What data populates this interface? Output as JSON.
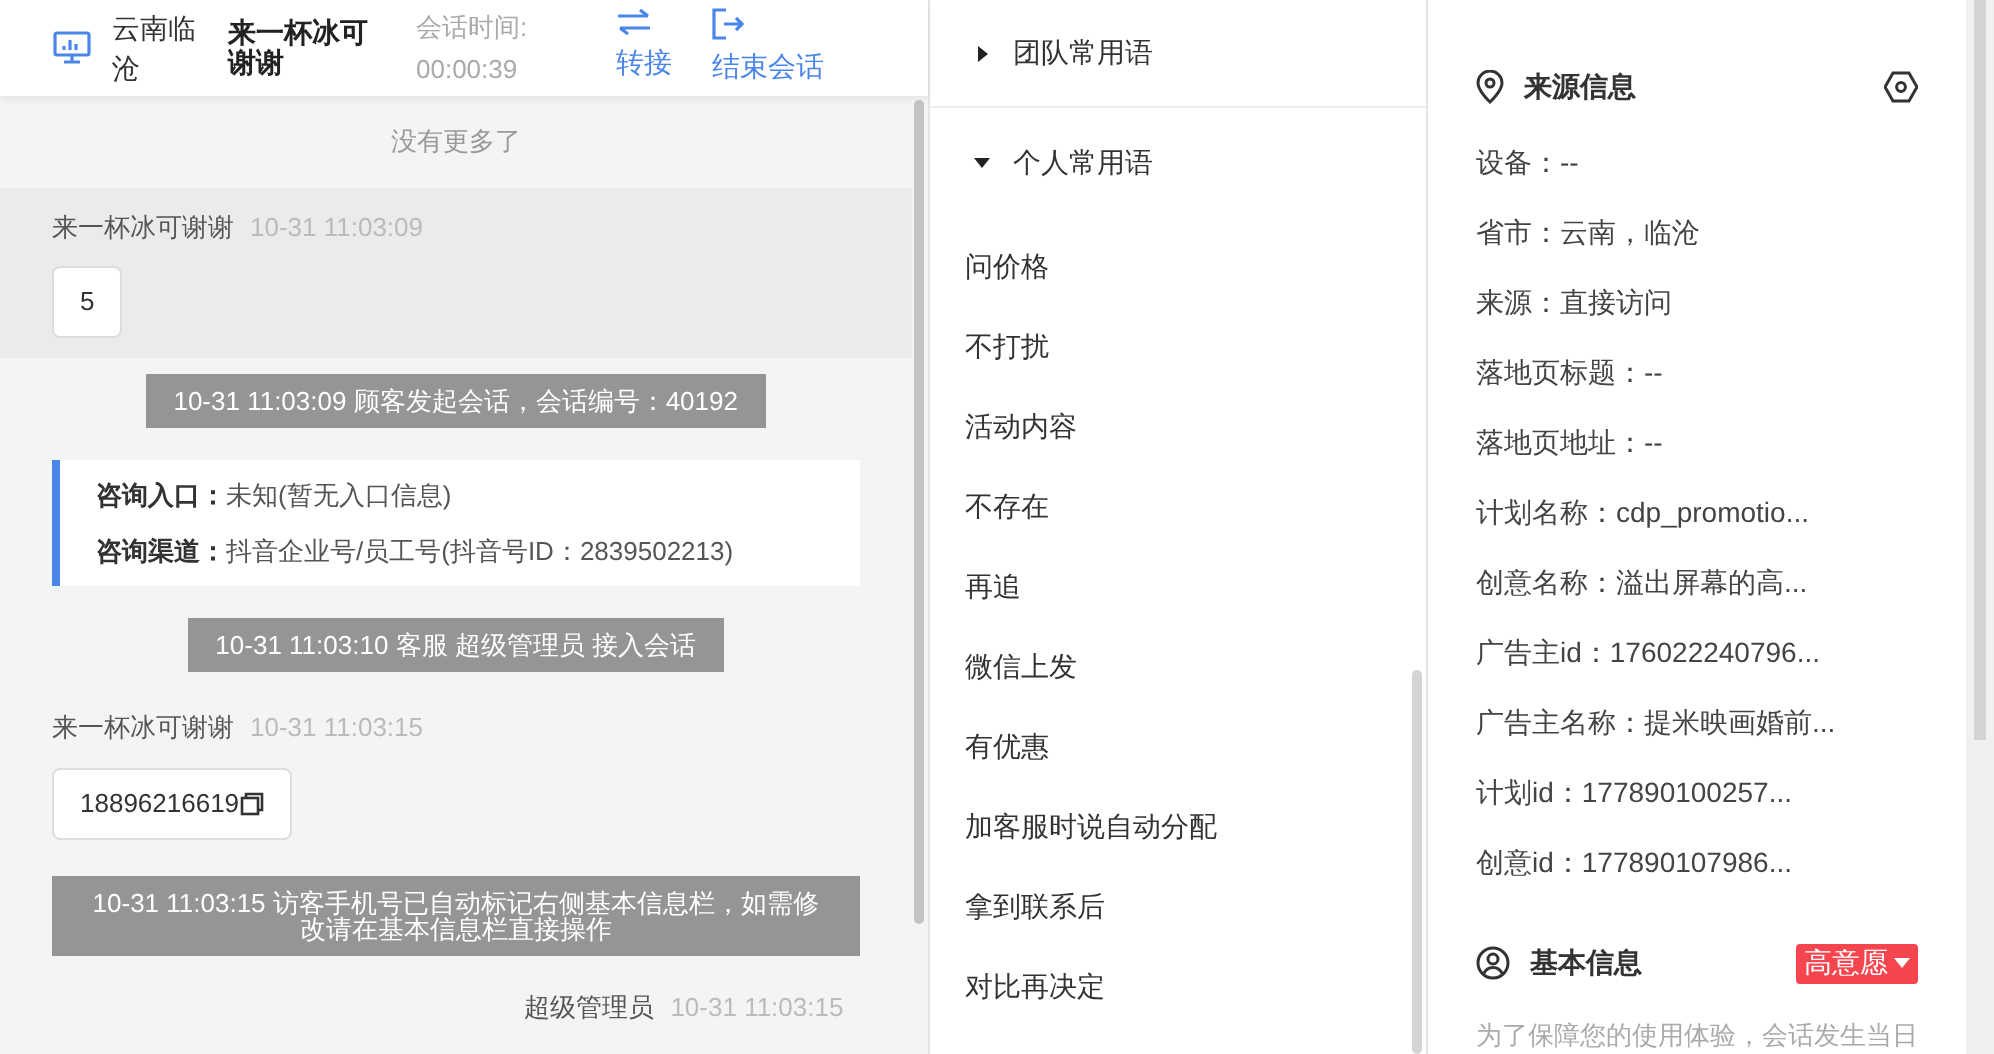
{
  "header": {
    "location": "云南临沧",
    "visitor": "来一杯冰可谢谢",
    "timer_label": "会话时间:",
    "timer": "00:00:39",
    "actions": [
      {
        "kind": "transfer",
        "label": "转接"
      },
      {
        "kind": "end",
        "label": "结束会话"
      }
    ]
  },
  "chat": {
    "no_more": "没有更多了",
    "messages": [
      {
        "kind": "visitor",
        "sender": "来一杯冰可谢谢",
        "time": "10-31 11:03:09",
        "text": "5",
        "highlighted": true,
        "copyable": false
      },
      {
        "kind": "system",
        "text": "10-31 11:03:09 顾客发起会话，会话编号：40192"
      },
      {
        "kind": "info",
        "lines": [
          {
            "label": "咨询入口：",
            "value": "未知(暂无入口信息)"
          },
          {
            "label": "咨询渠道：",
            "value": "抖音企业号/员工号(抖音号ID：2839502213)"
          }
        ]
      },
      {
        "kind": "system",
        "text": "10-31 11:03:10 客服 超级管理员 接入会话"
      },
      {
        "kind": "visitor",
        "sender": "来一杯冰可谢谢",
        "time": "10-31 11:03:15",
        "text": "18896216619",
        "highlighted": false,
        "copyable": true
      },
      {
        "kind": "system",
        "text": "10-31 11:03:15 访客手机号已自动标记右侧基本信息栏，如需修改请在基本信息栏直接操作"
      },
      {
        "kind": "agent",
        "sender": "超级管理员",
        "time": "10-31 11:03:15"
      }
    ]
  },
  "phrases": {
    "groups": [
      {
        "title": "团队常用语",
        "expanded": false
      },
      {
        "title": "个人常用语",
        "expanded": true
      }
    ],
    "items": [
      "问价格",
      "不打扰",
      "活动内容",
      "不存在",
      "再追",
      "微信上发",
      "有优惠",
      "加客服时说自动分配",
      "拿到联系后",
      "对比再决定"
    ]
  },
  "source_info": {
    "title": "来源信息",
    "fields": [
      "设备：--",
      "省市：云南，临沧",
      "来源：直接访问",
      "落地页标题：--",
      "落地页地址：--",
      "计划名称：cdp_promotio...",
      "创意名称：溢出屏幕的高...",
      "广告主id：176022240796...",
      "广告主名称：提米映画婚前...",
      "计划id：177890100257...",
      "创意id：177890107986..."
    ]
  },
  "basic_info": {
    "title": "基本信息",
    "tag": "高意愿",
    "notice": "为了保障您的使用体验，会话发生当日"
  }
}
